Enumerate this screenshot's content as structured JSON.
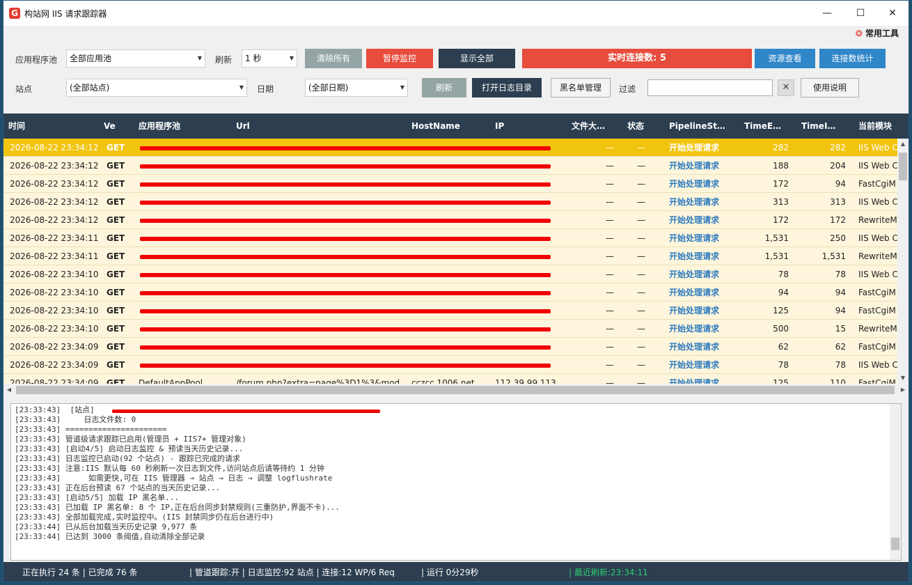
{
  "window": {
    "title": "构站网 IIS 请求跟踪器",
    "icon_letter": "G",
    "controls": [
      "—",
      "☐",
      "✕"
    ]
  },
  "tools_link": "常用工具",
  "toolbar1": {
    "app_pool_label": "应用程序池",
    "app_pool_value": "全部应用池",
    "refresh_label": "刷新",
    "refresh_value": "1 秒",
    "clear_all": "清除所有",
    "pause_monitor": "暂停监控",
    "show_all": "显示全部",
    "realtime_connections": "实时连接数: 5",
    "resource_view": "资源查看",
    "connection_stats": "连接数统计"
  },
  "toolbar2": {
    "site_label": "站点",
    "site_value": "(全部站点)",
    "date_label": "日期",
    "date_value": "(全部日期)",
    "refresh_btn": "刷新",
    "open_log_dir": "打开日志目录",
    "blacklist": "黑名单管理",
    "filter_label": "过滤",
    "filter_value": "",
    "clear_filter": "✕",
    "usage": "使用说明"
  },
  "grid": {
    "columns": [
      "时间",
      "Ve",
      "应用程序池",
      "Url",
      "HostName",
      "IP",
      "文件大…",
      "状态",
      "PipelineSt…",
      "TimeE…",
      "TimeI…",
      "当前模块"
    ],
    "rows": [
      {
        "time": "2026-08-22 23:34:12",
        "method": "GET",
        "size": "—",
        "status": "—",
        "pipeline": "开始处理请求",
        "te": "282",
        "ti": "282",
        "module": "IIS Web C",
        "selected": true
      },
      {
        "time": "2026-08-22 23:34:12",
        "method": "GET",
        "size": "—",
        "status": "—",
        "pipeline": "开始处理请求",
        "te": "188",
        "ti": "204",
        "module": "IIS Web C"
      },
      {
        "time": "2026-08-22 23:34:12",
        "method": "GET",
        "size": "—",
        "status": "—",
        "pipeline": "开始处理请求",
        "te": "172",
        "ti": "94",
        "module": "FastCgiM"
      },
      {
        "time": "2026-08-22 23:34:12",
        "method": "GET",
        "size": "—",
        "status": "—",
        "pipeline": "开始处理请求",
        "te": "313",
        "ti": "313",
        "module": "IIS Web C"
      },
      {
        "time": "2026-08-22 23:34:12",
        "method": "GET",
        "size": "—",
        "status": "—",
        "pipeline": "开始处理请求",
        "te": "172",
        "ti": "172",
        "module": "RewriteM"
      },
      {
        "time": "2026-08-22 23:34:11",
        "method": "GET",
        "size": "—",
        "status": "—",
        "pipeline": "开始处理请求",
        "te": "1,531",
        "ti": "250",
        "module": "IIS Web C"
      },
      {
        "time": "2026-08-22 23:34:11",
        "method": "GET",
        "size": "—",
        "status": "—",
        "pipeline": "开始处理请求",
        "te": "1,531",
        "ti": "1,531",
        "module": "RewriteM"
      },
      {
        "time": "2026-08-22 23:34:10",
        "method": "GET",
        "size": "—",
        "status": "—",
        "pipeline": "开始处理请求",
        "te": "78",
        "ti": "78",
        "module": "IIS Web C"
      },
      {
        "time": "2026-08-22 23:34:10",
        "method": "GET",
        "size": "—",
        "status": "—",
        "pipeline": "开始处理请求",
        "te": "94",
        "ti": "94",
        "module": "FastCgiM"
      },
      {
        "time": "2026-08-22 23:34:10",
        "method": "GET",
        "size": "—",
        "status": "—",
        "pipeline": "开始处理请求",
        "te": "125",
        "ti": "94",
        "module": "FastCgiM"
      },
      {
        "time": "2026-08-22 23:34:10",
        "method": "GET",
        "size": "—",
        "status": "—",
        "pipeline": "开始处理请求",
        "te": "500",
        "ti": "15",
        "module": "RewriteM"
      },
      {
        "time": "2026-08-22 23:34:09",
        "method": "GET",
        "size": "—",
        "status": "—",
        "pipeline": "开始处理请求",
        "te": "62",
        "ti": "62",
        "module": "FastCgiM"
      },
      {
        "time": "2026-08-22 23:34:09",
        "method": "GET",
        "size": "—",
        "status": "—",
        "pipeline": "开始处理请求",
        "te": "78",
        "ti": "78",
        "module": "IIS Web C"
      },
      {
        "time": "2026-08-22 23:34:09",
        "method": "GET",
        "pool": "DefaultAppPool",
        "url": "/forum.php?extra=page%3D1%3&mod",
        "host": "cczcc.1006.net",
        "ip": "112.39.99.113",
        "size": "—",
        "status": "—",
        "pipeline": "开始处理请求",
        "te": "125",
        "ti": "110",
        "module": "FastCgiM"
      }
    ]
  },
  "log": {
    "lines": [
      "[23:33:43]  [站点]",
      "[23:33:43]     日志文件数: 0",
      "[23:33:43] ======================",
      "[23:33:43] 管道级请求跟踪已启用(管理员 + IIS7+ 管理对象)",
      "[23:33:43] [启动4/5] 启动日志监控 & 预读当天历史记录...",
      "[23:33:43] 日志监控已启动(92 个站点) - 跟踪已完成的请求",
      "[23:33:43] 注意:IIS 默认每 60 秒刷新一次日志到文件,访问站点后请等待约 1 分钟",
      "[23:33:43]      如需更快,可在 IIS 管理器 → 站点 → 日志 → 调整 logflushrate",
      "[23:33:43] 正在后台预读 67 个站点的当天历史记录...",
      "[23:33:43] [启动5/5] 加载 IP 黑名单...",
      "[23:33:43] 已加载 IP 黑名单: 8 个 IP,正在后台同步封禁规则(三重防护,界面不卡)...",
      "[23:33:43] 全部加载完成,实时监控中。(IIS 封禁同步仍在后台进行中)",
      "[23:33:44] 已从后台加载当天历史记录 9,977 条",
      "[23:33:44] 已达到 3000 条阈值,自动清除全部记录"
    ]
  },
  "statusbar": {
    "executing": "正在执行 24 条 | 已完成 76 条",
    "pipeline_info": "| 管道跟踪:开 | 日志监控:92 站点 | 连接:12 WP/6 Req",
    "runtime": "| 运行 0分29秒",
    "last_refresh": "| 最近刷新:23:34:11"
  },
  "colors": {
    "header_bg": "#2c3e50",
    "selected_row": "#f1c40f",
    "row_bg": "#fdf6dc",
    "accent_red": "#e74c3c",
    "accent_blue": "#2f86c8",
    "pipeline_text": "#2f7bc0",
    "refresh_green": "#2ecc71"
  }
}
